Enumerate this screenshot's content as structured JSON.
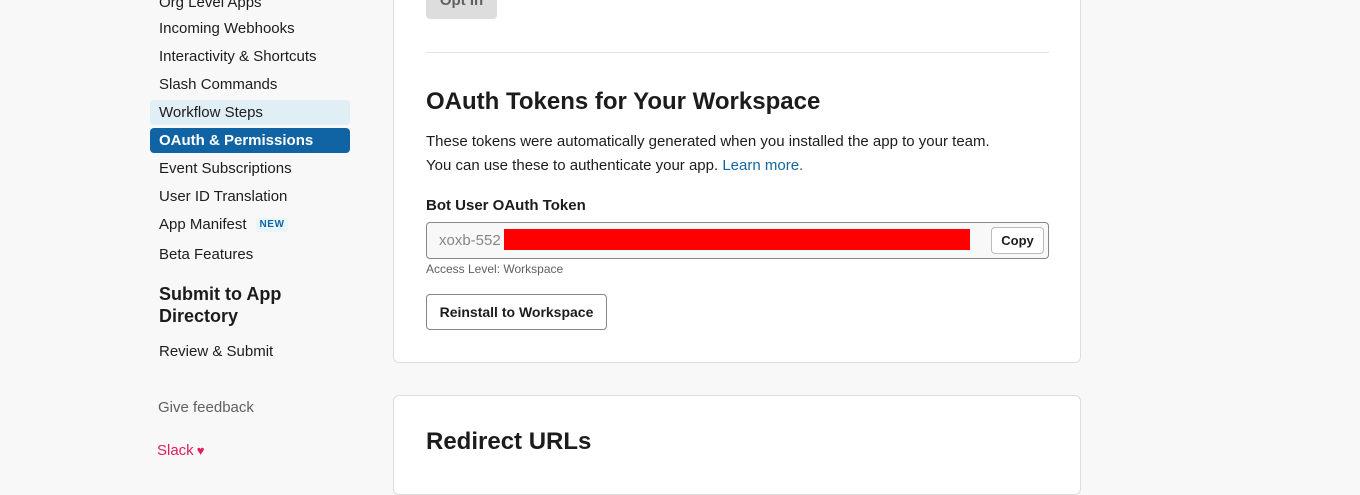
{
  "sidebar": {
    "items": [
      {
        "label": "Org Level Apps"
      },
      {
        "label": "Incoming Webhooks"
      },
      {
        "label": "Interactivity & Shortcuts"
      },
      {
        "label": "Slash Commands"
      },
      {
        "label": "Workflow Steps"
      },
      {
        "label": "OAuth & Permissions"
      },
      {
        "label": "Event Subscriptions"
      },
      {
        "label": "User ID Translation"
      },
      {
        "label": "App Manifest",
        "badge": "NEW"
      },
      {
        "label": "Beta Features"
      }
    ],
    "section_title": "Submit to App Directory",
    "section_items": [
      {
        "label": "Review & Submit"
      }
    ],
    "feedback": "Give feedback",
    "slack_label": "Slack",
    "heart_icon": "heart-icon"
  },
  "main": {
    "optin_label": "Opt In",
    "oauth_card": {
      "title": "OAuth Tokens for Your Workspace",
      "description_line1": "These tokens were automatically generated when you installed the app to your team.",
      "description_line2": "You can use these to authenticate your app.",
      "learn_more": "Learn more.",
      "token_label": "Bot User OAuth Token",
      "token_value": "xoxb-552",
      "copy_label": "Copy",
      "access_level": "Access Level: Workspace",
      "reinstall_label": "Reinstall to Workspace"
    },
    "redirect_card": {
      "title": "Redirect URLs"
    }
  },
  "colors": {
    "accent": "#1164a3",
    "link": "#1264a3",
    "redaction": "#ff0000",
    "slack_pink": "#e01e5a"
  }
}
